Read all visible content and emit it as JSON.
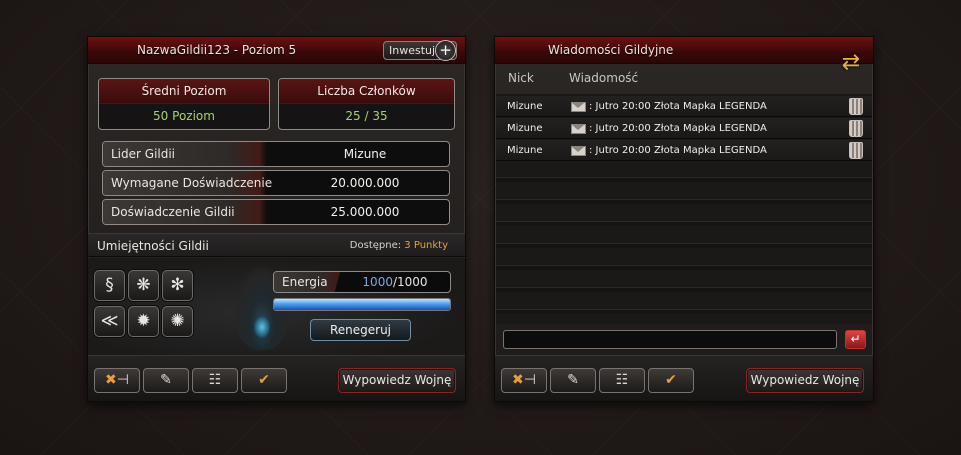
{
  "guild": {
    "title": "NazwaGildii123 - Poziom 5",
    "invest_label": "Inwestuj",
    "invest_icon": "plus-icon",
    "avg_level": {
      "label": "Średni Poziom",
      "value": "50 Poziom"
    },
    "members": {
      "label": "Liczba Członków",
      "value": "25 / 35"
    },
    "info": [
      {
        "label": "Lider Gildii",
        "value": "Mizune"
      },
      {
        "label": "Wymagane Doświadczenie",
        "value": "20.000.000"
      },
      {
        "label": "Doświadczenie Gildii",
        "value": "25.000.000"
      }
    ],
    "skills": {
      "title": "Umiejętności Gildii",
      "available_label": "Dostępne:",
      "available_points": "3 Punkty",
      "icons": [
        "dragon-icon",
        "snowflake-icon",
        "frost-icon",
        "feather-icon",
        "sun-icon",
        "gear-icon"
      ]
    },
    "energy": {
      "label": "Energia",
      "current": "1000",
      "max": "/1000",
      "fraction": 1.0,
      "regen_label": "Renegeruj"
    },
    "toolbar": {
      "buttons": [
        "kick-member-icon",
        "edit-note-icon",
        "members-list-icon",
        "accept-member-icon"
      ],
      "war_label": "Wypowiedz Wojnę"
    }
  },
  "messages": {
    "title": "Wiadomości Gildyjne",
    "refresh_icon": "refresh-icon",
    "columns": {
      "nick": "Nick",
      "message": "Wiadomość"
    },
    "rows": [
      {
        "nick": "Mizune",
        "text": ": Jutro 20:00 Złota Mapka LEGENDA"
      },
      {
        "nick": "Mizune",
        "text": ": Jutro 20:00 Złota Mapka LEGENDA"
      },
      {
        "nick": "Mizune",
        "text": ": Jutro 20:00 Złota Mapka LEGENDA"
      }
    ],
    "input_value": "",
    "input_placeholder": "",
    "toolbar": {
      "buttons": [
        "kick-member-icon",
        "edit-note-icon",
        "members-list-icon",
        "accept-member-icon"
      ],
      "war_label": "Wypowiedz Wojnę"
    }
  },
  "colors": {
    "accent_red": "#6e1010",
    "value_green": "#a6d26e",
    "points_orange": "#e8a035",
    "energy_blue": "#4aa0f0"
  }
}
